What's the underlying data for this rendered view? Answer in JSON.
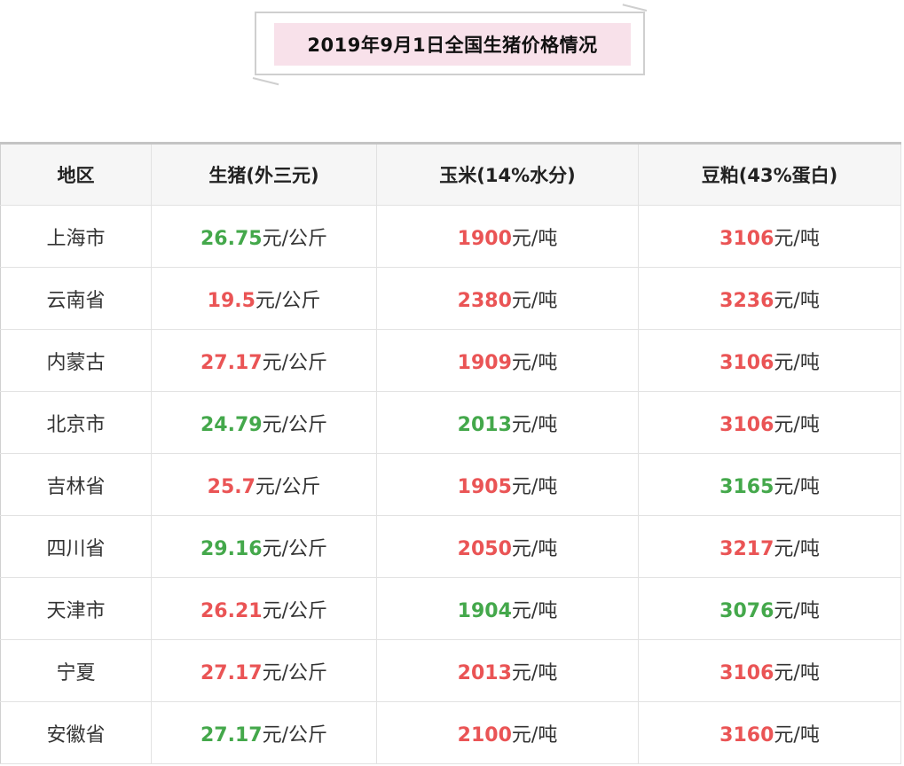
{
  "title": "2019年9月1日全国生猪价格情况",
  "colors": {
    "red": "#ea5455",
    "green": "#44a84b",
    "banner": "#f8e1ea"
  },
  "table": {
    "headers": [
      "地区",
      "生猪(外三元)",
      "玉米(14%水分)",
      "豆粕(43%蛋白)"
    ],
    "pig_unit": "元/公斤",
    "feed_unit": "元/吨",
    "rows": [
      {
        "region": "上海市",
        "pig": {
          "value": "26.75",
          "color": "green"
        },
        "corn": {
          "value": "1900",
          "color": "red"
        },
        "soy": {
          "value": "3106",
          "color": "red"
        }
      },
      {
        "region": "云南省",
        "pig": {
          "value": "19.5",
          "color": "red"
        },
        "corn": {
          "value": "2380",
          "color": "red"
        },
        "soy": {
          "value": "3236",
          "color": "red"
        }
      },
      {
        "region": "内蒙古",
        "pig": {
          "value": "27.17",
          "color": "red"
        },
        "corn": {
          "value": "1909",
          "color": "red"
        },
        "soy": {
          "value": "3106",
          "color": "red"
        }
      },
      {
        "region": "北京市",
        "pig": {
          "value": "24.79",
          "color": "green"
        },
        "corn": {
          "value": "2013",
          "color": "green"
        },
        "soy": {
          "value": "3106",
          "color": "red"
        }
      },
      {
        "region": "吉林省",
        "pig": {
          "value": "25.7",
          "color": "red"
        },
        "corn": {
          "value": "1905",
          "color": "red"
        },
        "soy": {
          "value": "3165",
          "color": "green"
        }
      },
      {
        "region": "四川省",
        "pig": {
          "value": "29.16",
          "color": "green"
        },
        "corn": {
          "value": "2050",
          "color": "red"
        },
        "soy": {
          "value": "3217",
          "color": "red"
        }
      },
      {
        "region": "天津市",
        "pig": {
          "value": "26.21",
          "color": "red"
        },
        "corn": {
          "value": "1904",
          "color": "green"
        },
        "soy": {
          "value": "3076",
          "color": "green"
        }
      },
      {
        "region": "宁夏",
        "pig": {
          "value": "27.17",
          "color": "red"
        },
        "corn": {
          "value": "2013",
          "color": "red"
        },
        "soy": {
          "value": "3106",
          "color": "red"
        }
      },
      {
        "region": "安徽省",
        "pig": {
          "value": "27.17",
          "color": "green"
        },
        "corn": {
          "value": "2100",
          "color": "red"
        },
        "soy": {
          "value": "3160",
          "color": "red"
        }
      }
    ]
  }
}
